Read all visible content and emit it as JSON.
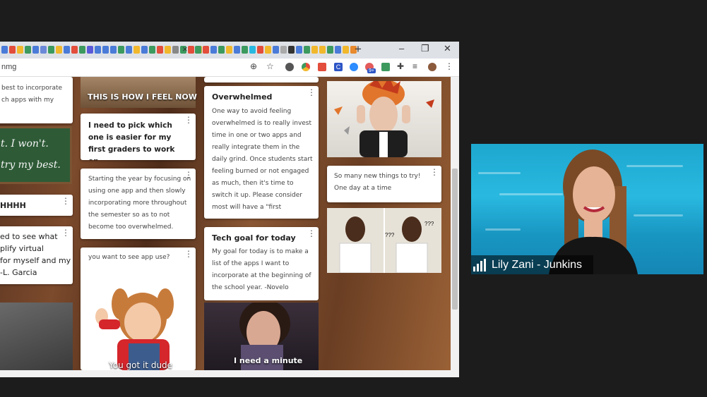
{
  "browser": {
    "url": "nmg",
    "tab_close": "×",
    "new_tab": "+",
    "window_controls": {
      "minimize": "–",
      "restore": "❐",
      "close": "✕"
    },
    "toolbar_icons": [
      "target-icon",
      "star-icon",
      "circle-extension-icon",
      "chrome-extension-icon",
      "play-extension-icon",
      "c-extension-icon",
      "zoom-extension-icon",
      "notification-badge-icon",
      "screenshot-extension-icon",
      "puzzle-extensions-icon",
      "playlist-icon",
      "profile-avatar",
      "more-menu-icon"
    ],
    "badge": "9+"
  },
  "padlet": {
    "col1": {
      "card1_text": "best to incorporate\nch apps with my",
      "chalk_lines": [
        "t.   I won't.",
        "try my best."
      ],
      "card2_title": "HHHH",
      "card3_text": "ed to see what\nplify virtual\nfor myself and my\n-L. Garcia"
    },
    "col2": {
      "image1_caption": "THIS IS HOW I FEEL NOW",
      "card1_text": "I need to pick which one is easier for my first graders to work on",
      "card2_text": "Starting the year by focusing on using one app and then slowly incorporating more throughout the semester so as to not become too overwhelmed.",
      "card3_text": "you want to see app use?",
      "gif_caption": "You got it dude"
    },
    "col3": {
      "card1_title": "Overwhelmed",
      "card1_text": "One way to avoid feeling overwhelmed is to really invest time in one or two apps and really integrate them in the daily grind. Once students start feeling burned or not engaged as much, then it's time to switch it up. Please consider most will have a \"first",
      "card2_title": "Tech goal for today",
      "card2_text": "My goal for today is to make a list of the apps I want to incorporate at the beginning of the school year. -Novelo",
      "gif_caption": "I need a minute"
    },
    "col4": {
      "card1_text": "So many new things to try! One day at a time",
      "meme_marks": [
        "???",
        "???"
      ]
    },
    "fab_label": "+"
  },
  "video": {
    "participant_name": "Lily Zani - Junkins"
  },
  "colors": {
    "fab": "#f0336e",
    "tabstrip": "#dee1e6",
    "water": "#29b9e0"
  }
}
